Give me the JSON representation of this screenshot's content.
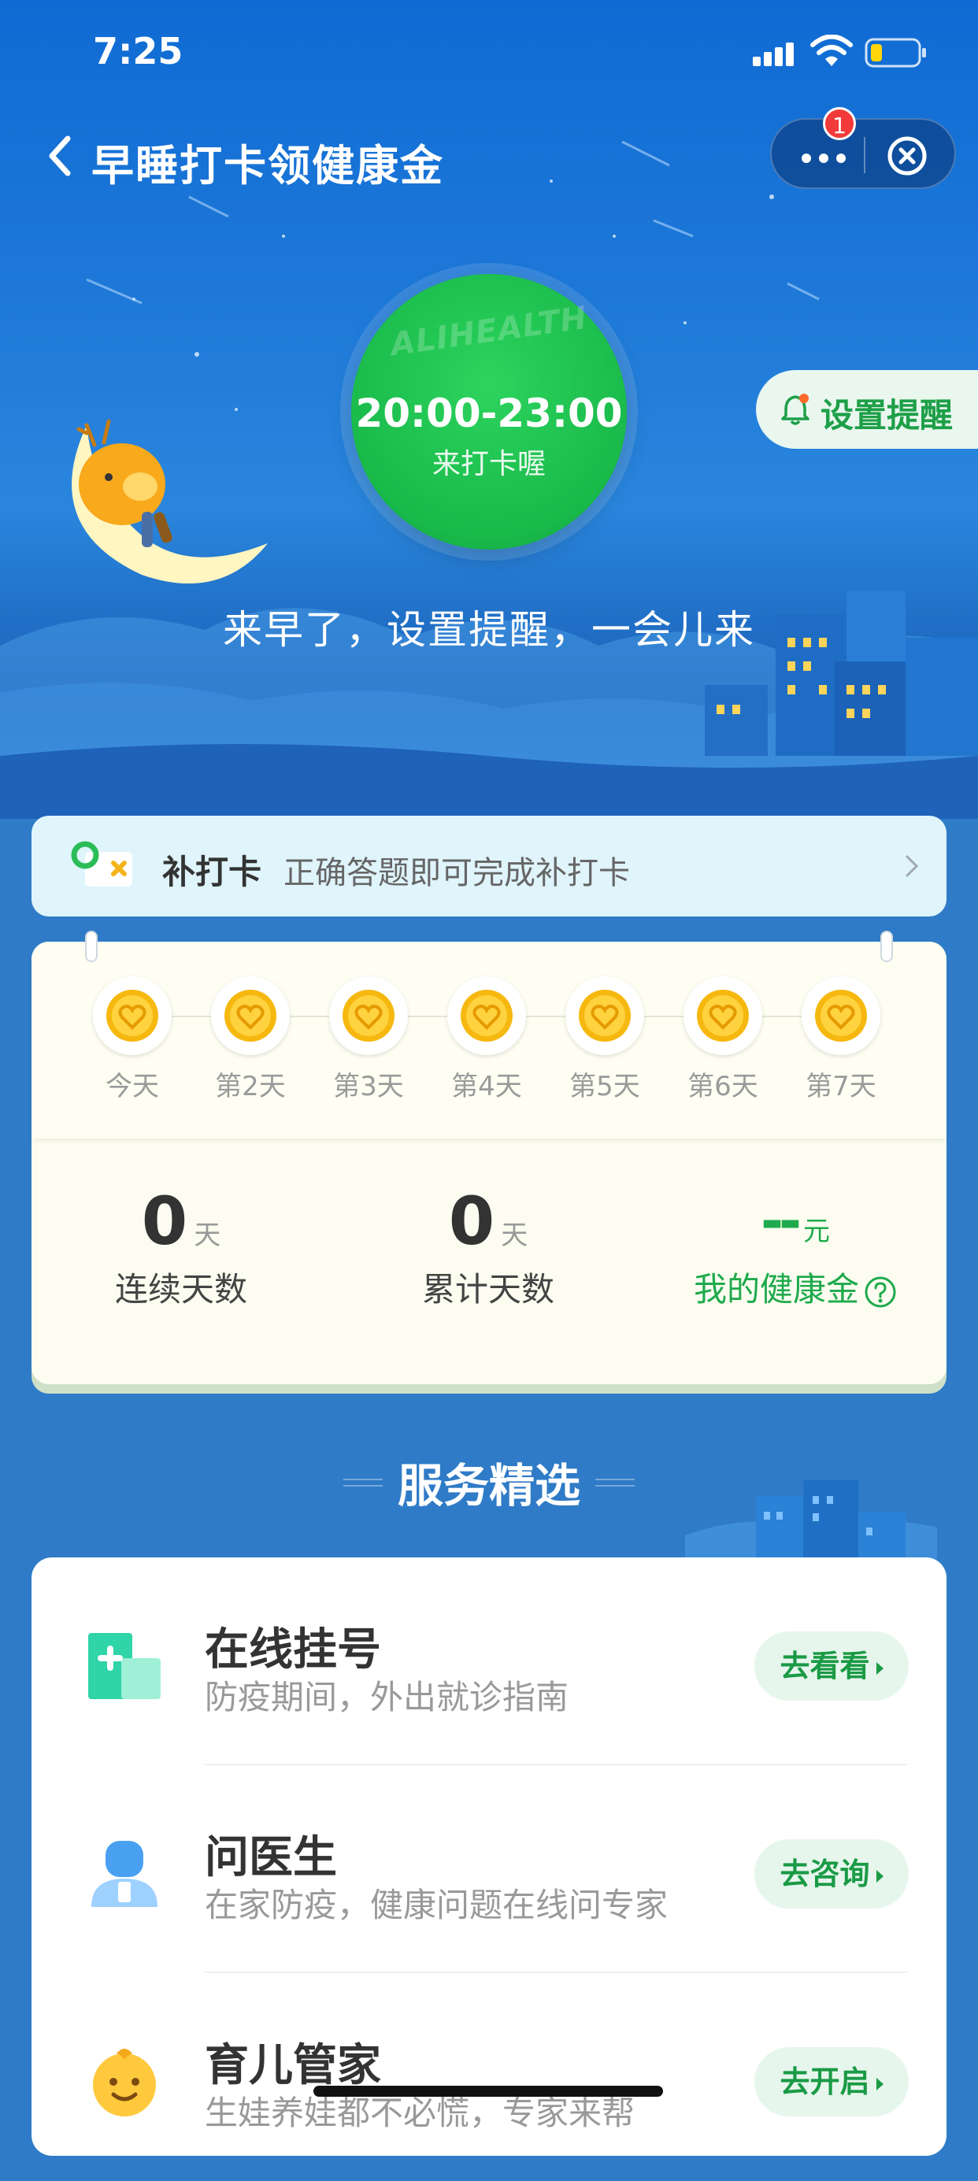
{
  "status_bar": {
    "time": "7:25"
  },
  "nav": {
    "title": "早睡打卡领健康金",
    "notification_count": "1"
  },
  "hero": {
    "brand": "ALIHEALTH",
    "time_range": "20:00-23:00",
    "subtitle": "来打卡喔",
    "reminder_label": "设置提醒",
    "hint": "来早了，设置提醒，一会儿来"
  },
  "makeup": {
    "title": "补打卡",
    "desc": "正确答题即可完成补打卡"
  },
  "checkin": {
    "days": [
      {
        "label": "今天"
      },
      {
        "label": "第2天"
      },
      {
        "label": "第3天"
      },
      {
        "label": "第4天"
      },
      {
        "label": "第5天"
      },
      {
        "label": "第6天"
      },
      {
        "label": "第7天"
      }
    ],
    "stats": [
      {
        "value": "0",
        "unit": "天",
        "label": "连续天数"
      },
      {
        "value": "0",
        "unit": "天",
        "label": "累计天数"
      },
      {
        "value": "--",
        "unit": "元",
        "label": "我的健康金"
      }
    ]
  },
  "services": {
    "title": "服务精选",
    "items": [
      {
        "title": "在线挂号",
        "desc": "防疫期间，外出就诊指南",
        "button": "去看看",
        "icon": "hospital-icon"
      },
      {
        "title": "问医生",
        "desc": "在家防疫，健康问题在线问专家",
        "button": "去咨询",
        "icon": "doctor-icon"
      },
      {
        "title": "育儿管家",
        "desc": "生娃养娃都不必慌，专家来帮",
        "button": "去开启",
        "icon": "baby-icon"
      }
    ]
  },
  "colors": {
    "accent_green": "#1faa4d",
    "hero_blue": "#1d78d8",
    "badge_red": "#f23a3a"
  }
}
